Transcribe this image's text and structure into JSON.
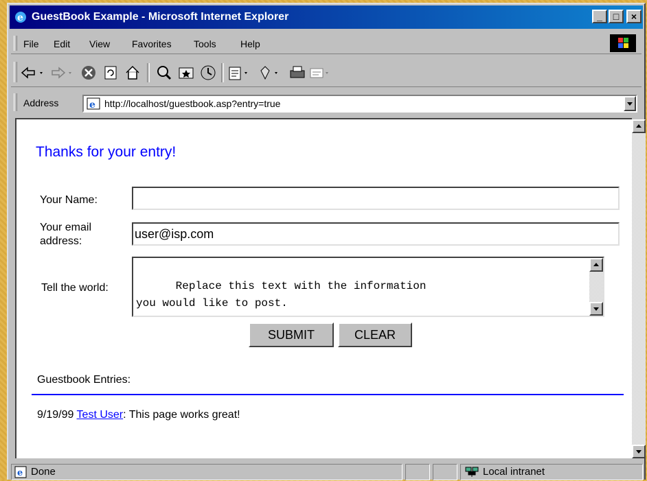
{
  "window": {
    "title": "GuestBook Example - Microsoft Internet Explorer"
  },
  "menu": [
    "File",
    "Edit",
    "View",
    "Favorites",
    "Tools",
    "Help"
  ],
  "toolbar_icons": [
    "back-icon",
    "forward-icon",
    "stop-icon",
    "refresh-icon",
    "home-icon",
    "search-icon",
    "favorites-icon",
    "history-icon",
    "mail-icon",
    "print-icon",
    "edit-icon",
    "discuss-icon"
  ],
  "address": {
    "label": "Address",
    "url": "http://localhost/guestbook.asp?entry=true"
  },
  "page": {
    "heading": "Thanks for your entry!",
    "name_label": "Your Name:",
    "name_value": "",
    "email_label_line1": "Your email",
    "email_label_line2": "address:",
    "email_value": "user@isp.com",
    "message_label": "Tell the world:",
    "message_value": "Replace this text with the information\nyou would like to post.",
    "submit_label": "SUBMIT",
    "clear_label": "CLEAR",
    "entries_heading": "Guestbook Entries:",
    "entries": [
      {
        "date": "9/19/99",
        "author": "Test User",
        "message": ": This page works great!"
      }
    ]
  },
  "status": {
    "text": "Done",
    "zone": "Local intranet"
  },
  "colors": {
    "title_start": "#000080",
    "title_end": "#1084d0",
    "link": "#0000ff"
  }
}
